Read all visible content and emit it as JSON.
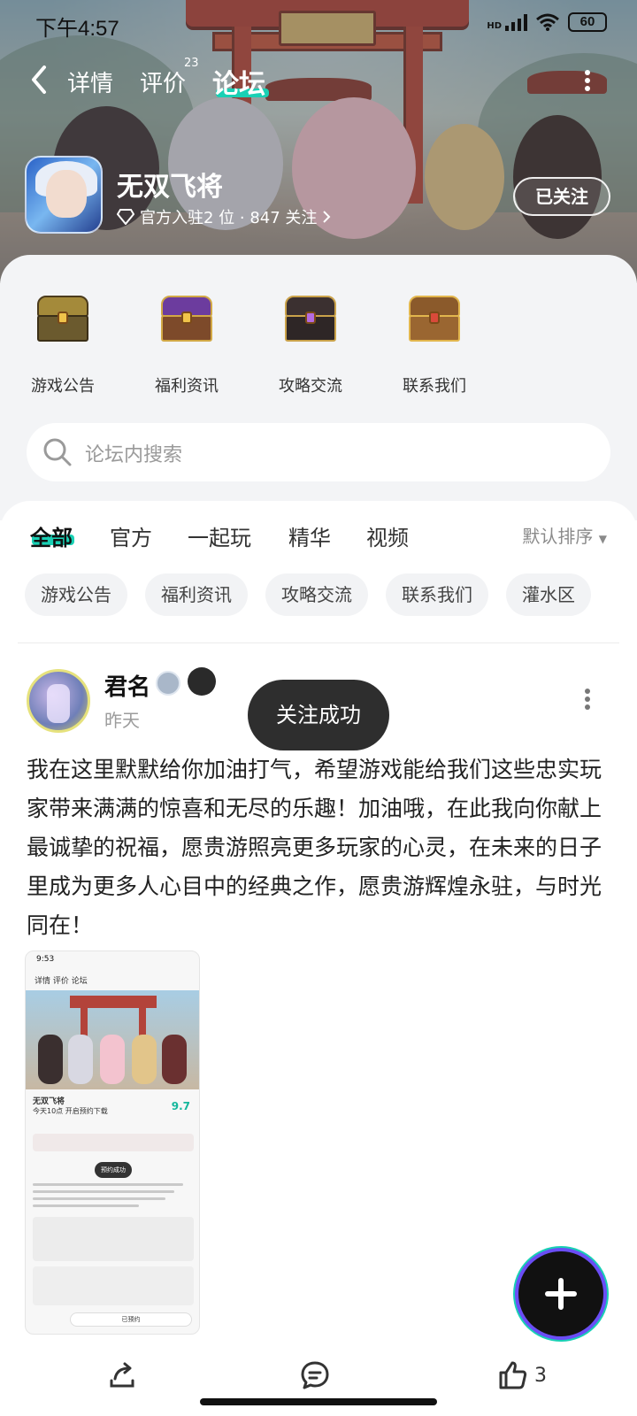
{
  "status_bar": {
    "time": "下午4:57",
    "network": "HD",
    "battery": "60"
  },
  "nav": {
    "tabs": [
      {
        "label": "详情"
      },
      {
        "label": "评价",
        "badge": "23"
      },
      {
        "label": "论坛"
      }
    ],
    "active_tab": "论坛"
  },
  "game": {
    "title": "无双飞将",
    "meta": "官方入驻2 位 · 847 关注",
    "follow_label": "已关注"
  },
  "categories": [
    {
      "label": "游戏公告",
      "icon": "gold-chest-icon"
    },
    {
      "label": "福利资讯",
      "icon": "purple-chest-icon"
    },
    {
      "label": "攻略交流",
      "icon": "gem-chest-icon"
    },
    {
      "label": "联系我们",
      "icon": "treasure-chest-icon"
    }
  ],
  "search": {
    "placeholder": "论坛内搜索"
  },
  "filter_tabs": [
    {
      "label": "全部"
    },
    {
      "label": "官方"
    },
    {
      "label": "一起玩"
    },
    {
      "label": "精华"
    },
    {
      "label": "视频"
    }
  ],
  "sort_label": "默认排序",
  "chips": [
    "游戏公告",
    "福利资讯",
    "攻略交流",
    "联系我们",
    "灌水区"
  ],
  "post": {
    "author": "君名",
    "time": "昨天",
    "body": "我在这里默默给你加油打气，希望游戏能给我们这些忠实玩家带来满满的惊喜和无尽的乐趣！加油哦，在此我向你献上最诚挚的祝福，愿贵游照亮更多玩家的心灵，在未来的日子里成为更多人心目中的经典之作，愿贵游辉煌永驻，与时光同在！",
    "thumbnail": {
      "status_time": "9:53",
      "nav": "详情   评价   论坛",
      "game_name": "无双飞将",
      "game_sub": "今天10点 开启预约下载",
      "score": "9.7",
      "toast": "预约成功",
      "button": "已预约"
    }
  },
  "toast": "关注成功",
  "actions": {
    "like_count": "3"
  },
  "colors": {
    "accent": "#19d0b4",
    "toast_bg": "#2e2e2e"
  }
}
